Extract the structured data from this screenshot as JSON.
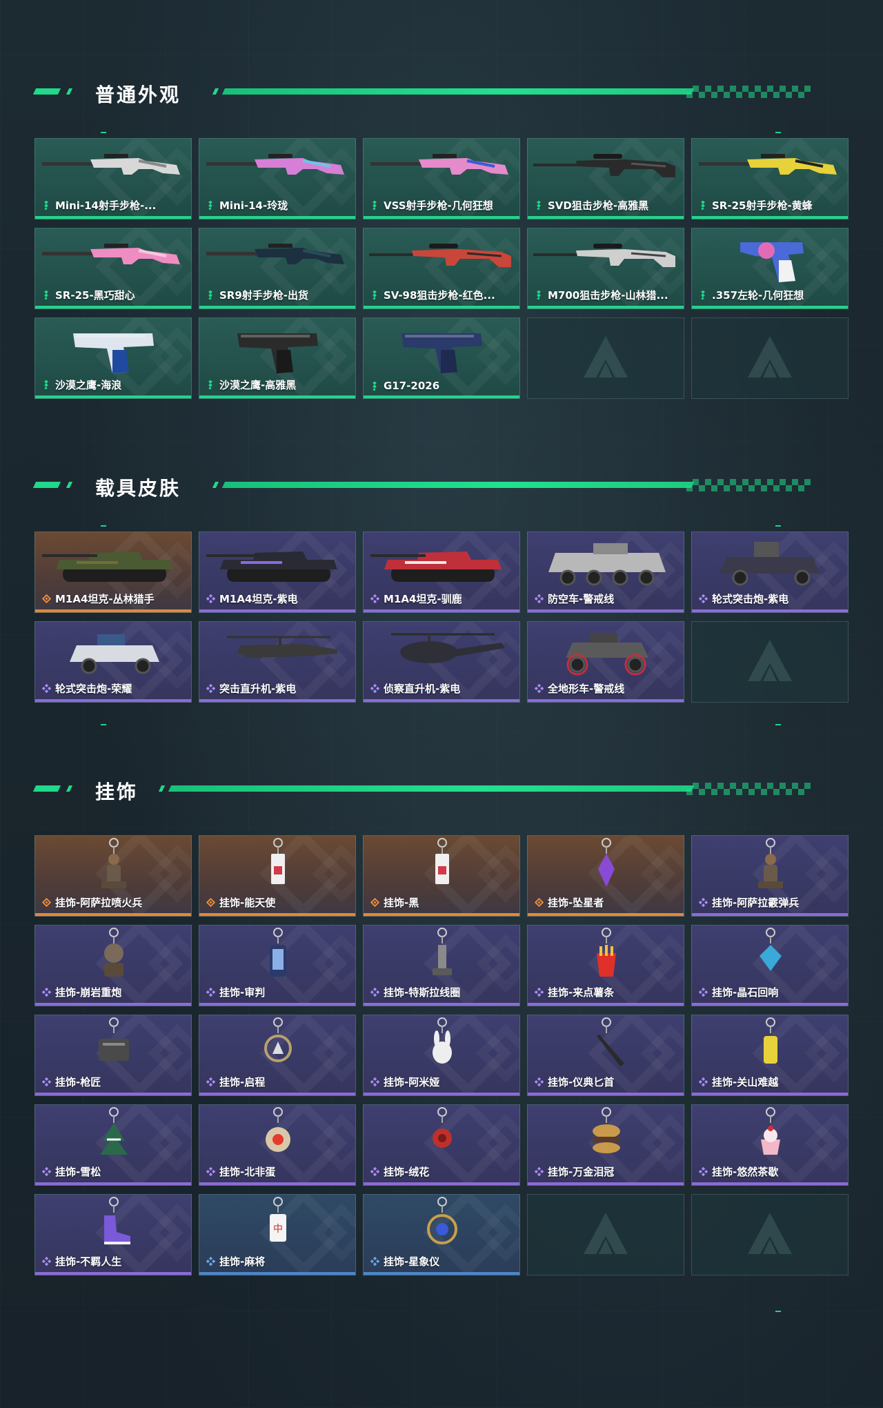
{
  "sections": [
    {
      "title": "普通外观",
      "items": [
        {
          "label": "Mini-14射手步枪-...",
          "rarity": "green",
          "art": "rifle-white"
        },
        {
          "label": "Mini-14-玲珑",
          "rarity": "green",
          "art": "rifle-pastel"
        },
        {
          "label": "VSS射手步枪-几何狂想",
          "rarity": "green",
          "art": "vss-pink"
        },
        {
          "label": "SVD狙击步枪-高雅黑",
          "rarity": "green",
          "art": "sniper-black"
        },
        {
          "label": "SR-25射手步枪-黄蜂",
          "rarity": "green",
          "art": "rifle-yellow"
        },
        {
          "label": "SR-25-黑巧甜心",
          "rarity": "green",
          "art": "rifle-pink"
        },
        {
          "label": "SR9射手步枪-出货",
          "rarity": "green",
          "art": "rifle-teal"
        },
        {
          "label": "SV-98狙击步枪-红色...",
          "rarity": "green",
          "art": "sniper-red"
        },
        {
          "label": "M700狙击步枪-山林猎...",
          "rarity": "green",
          "art": "sniper-white"
        },
        {
          "label": ".357左轮-几何狂想",
          "rarity": "green",
          "art": "revolver"
        },
        {
          "label": "沙漠之鹰-海浪",
          "rarity": "green",
          "art": "pistol-blue"
        },
        {
          "label": "沙漠之鹰-高雅黑",
          "rarity": "green",
          "art": "pistol-black"
        },
        {
          "label": "G17-2026",
          "rarity": "green",
          "art": "pistol-navy"
        },
        {
          "empty": true
        },
        {
          "empty": true
        }
      ]
    },
    {
      "title": "载具皮肤",
      "items": [
        {
          "label": "M1A4坦克-丛林猎手",
          "rarity": "orange",
          "art": "tank-camo"
        },
        {
          "label": "M1A4坦克-紫电",
          "rarity": "purple",
          "art": "tank-dark"
        },
        {
          "label": "M1A4坦克-驯鹿",
          "rarity": "purple",
          "art": "tank-red"
        },
        {
          "label": "防空车-警戒线",
          "rarity": "purple",
          "art": "apc"
        },
        {
          "label": "轮式突击炮-紫电",
          "rarity": "purple",
          "art": "buggy-dark"
        },
        {
          "label": "轮式突击炮-荣耀",
          "rarity": "purple",
          "art": "buggy-white"
        },
        {
          "label": "突击直升机-紫电",
          "rarity": "purple",
          "art": "heli-attack"
        },
        {
          "label": "侦察直升机-紫电",
          "rarity": "purple",
          "art": "heli-scout"
        },
        {
          "label": "全地形车-警戒线",
          "rarity": "purple",
          "art": "atv"
        },
        {
          "empty": true
        }
      ]
    },
    {
      "title": "挂饰",
      "items": [
        {
          "label": "挂饰-阿萨拉喷火兵",
          "rarity": "orange",
          "art": "charm-soldier"
        },
        {
          "label": "挂饰-能天使",
          "rarity": "orange",
          "art": "charm-card"
        },
        {
          "label": "挂饰-黑",
          "rarity": "orange",
          "art": "charm-card"
        },
        {
          "label": "挂饰-坠星者",
          "rarity": "orange",
          "art": "charm-crystal"
        },
        {
          "label": "挂饰-阿萨拉霰弹兵",
          "rarity": "purple",
          "art": "charm-soldier"
        },
        {
          "label": "挂饰-崩岩重炮",
          "rarity": "purple",
          "art": "charm-bust"
        },
        {
          "label": "挂饰-审判",
          "rarity": "purple",
          "art": "charm-phone"
        },
        {
          "label": "挂饰-特斯拉线圈",
          "rarity": "purple",
          "art": "charm-coil"
        },
        {
          "label": "挂饰-来点薯条",
          "rarity": "purple",
          "art": "charm-fries"
        },
        {
          "label": "挂饰-晶石回响",
          "rarity": "purple",
          "art": "charm-gem"
        },
        {
          "label": "挂饰-枪匠",
          "rarity": "purple",
          "art": "charm-bag"
        },
        {
          "label": "挂饰-启程",
          "rarity": "purple",
          "art": "charm-medal"
        },
        {
          "label": "挂饰-阿米娅",
          "rarity": "purple",
          "art": "charm-bunny"
        },
        {
          "label": "挂饰-仪典匕首",
          "rarity": "purple",
          "art": "charm-knife"
        },
        {
          "label": "挂饰-关山难越",
          "rarity": "purple",
          "art": "charm-can"
        },
        {
          "label": "挂饰-雪松",
          "rarity": "purple",
          "art": "charm-tree"
        },
        {
          "label": "挂饰-北非蛋",
          "rarity": "purple",
          "art": "charm-plate"
        },
        {
          "label": "挂饰-绒花",
          "rarity": "purple",
          "art": "charm-flower"
        },
        {
          "label": "挂饰-万金泪冠",
          "rarity": "purple",
          "art": "charm-burger"
        },
        {
          "label": "挂饰-悠然茶歇",
          "rarity": "purple",
          "art": "charm-cake"
        },
        {
          "label": "挂饰-不羁人生",
          "rarity": "purple",
          "art": "charm-shoe"
        },
        {
          "label": "挂饰-麻将",
          "rarity": "blue",
          "art": "charm-mahjong"
        },
        {
          "label": "挂饰-星象仪",
          "rarity": "blue",
          "art": "charm-orb"
        },
        {
          "empty": true
        },
        {
          "empty": true
        }
      ]
    }
  ],
  "colors": {
    "accent_green": "#20d98a",
    "rarity_green": "#22d58a",
    "rarity_purple": "#8d6bd6",
    "rarity_orange": "#e08a3a",
    "rarity_blue": "#4b86c9"
  }
}
